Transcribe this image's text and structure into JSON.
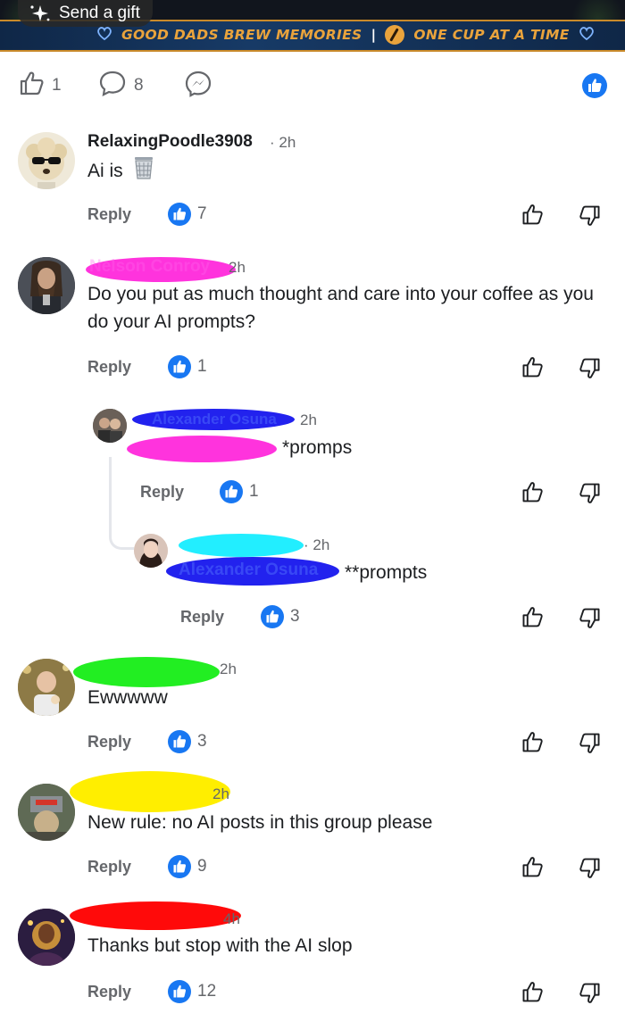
{
  "banner": {
    "send_gift_label": "Send a gift",
    "slogan_left": "GOOD DADS BREW MEMORIES",
    "slogan_sep": "|",
    "slogan_right": "ONE CUP AT A TIME"
  },
  "post_actions": {
    "likes_count": "1",
    "comments_count": "8"
  },
  "colors": {
    "accent": "#1877f2",
    "muted": "#65676b",
    "slogan": "#e9a33c"
  },
  "comments": [
    {
      "author": "RelaxingPoodle3908",
      "time": "· 2h",
      "text": "Ai is",
      "emoji": "wastebasket-icon",
      "reply_label": "Reply",
      "likes": "7"
    },
    {
      "author": "Nelson Conroy",
      "time": "2h",
      "text": "Do you put as much thought and care into your coffee as you do your AI prompts?",
      "reply_label": "Reply",
      "likes": "1"
    },
    {
      "author": "Alexander Osuna",
      "time": "2h",
      "text": "*promps",
      "reply_label": "Reply",
      "likes": "1"
    },
    {
      "author": "",
      "time": "· 2h",
      "mention": "Alexander Osuna",
      "text": "**prompts",
      "reply_label": "Reply",
      "likes": "3"
    },
    {
      "author": "",
      "time": "2h",
      "text": "Ewwwww",
      "reply_label": "Reply",
      "likes": "3"
    },
    {
      "author": "",
      "time": "2h",
      "text": "New rule: no AI posts in this group please",
      "reply_label": "Reply",
      "likes": "9"
    },
    {
      "author": "",
      "time": "4h",
      "text": "Thanks but stop with the AI slop",
      "reply_label": "Reply",
      "likes": "12"
    }
  ]
}
